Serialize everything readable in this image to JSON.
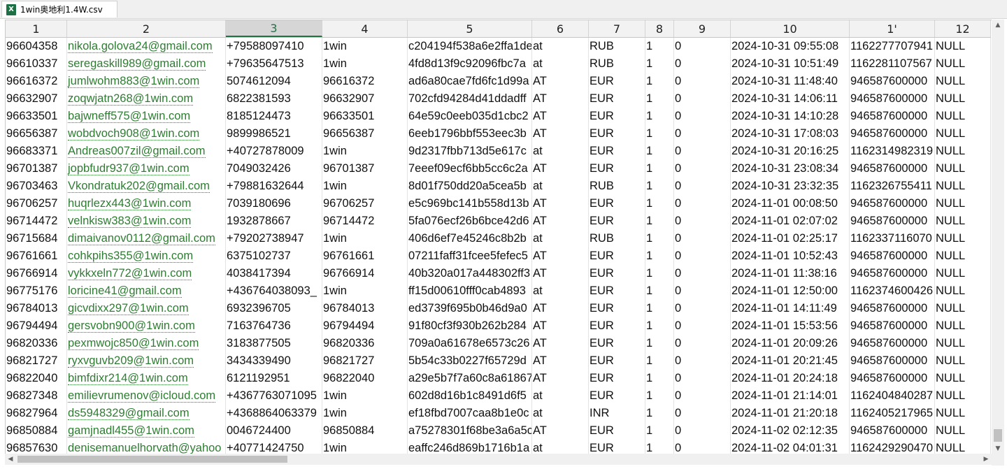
{
  "tab": {
    "name": "1win奥地利1.4W.csv",
    "icon": "excel-icon"
  },
  "columns": [
    "1",
    "2",
    "3",
    "4",
    "5",
    "6",
    "7",
    "8",
    "9",
    "10",
    "1'",
    "12"
  ],
  "active_column": 2,
  "rows": [
    [
      "96604358",
      "nikola.golova24@gmail.com",
      "+79588097410",
      "1win",
      "c204194f538a6e2ffa1de",
      "at",
      "RUB",
      "1",
      "0",
      "2024-10-31 09:55:08",
      "1162277707941",
      "NULL"
    ],
    [
      "96610337",
      "seregaskill989@gmail.com",
      "+79635647513",
      "1win",
      "4fd8d13f9c92096fbc7a",
      "at",
      "RUB",
      "1",
      "0",
      "2024-10-31 10:51:49",
      "1162281107567",
      "NULL"
    ],
    [
      "96616372",
      "jumlwohm883@1win.com",
      "5074612094",
      "96616372",
      "ad6a80cae7fd6fc1d99a",
      "AT",
      "EUR",
      "1",
      "0",
      "2024-10-31 11:48:40",
      "946587600000",
      "NULL"
    ],
    [
      "96632907",
      "zoqwjatn268@1win.com",
      "6822381593",
      "96632907",
      "702cfd94284d41ddadff",
      "AT",
      "EUR",
      "1",
      "0",
      "2024-10-31 14:06:11",
      "946587600000",
      "NULL"
    ],
    [
      "96633501",
      "bajwneff575@1win.com",
      "8185124473",
      "96633501",
      "64e59c0eeb035d1cbc2",
      "AT",
      "EUR",
      "1",
      "0",
      "2024-10-31 14:10:28",
      "946587600000",
      "NULL"
    ],
    [
      "96656387",
      "wobdvoch908@1win.com",
      "9899986521",
      "96656387",
      "6eeb1796bbf553eec3b",
      "AT",
      "EUR",
      "1",
      "0",
      "2024-10-31 17:08:03",
      "946587600000",
      "NULL"
    ],
    [
      "96683371",
      "Andreas007zil@gmail.com",
      "+40727878009",
      "1win",
      "9d2317fbb713d5e617c",
      "at",
      "EUR",
      "1",
      "0",
      "2024-10-31 20:16:25",
      "1162314982319",
      "NULL"
    ],
    [
      "96701387",
      "jopbfudr937@1win.com",
      "7049032426",
      "96701387",
      "7eeef09ecf6bb5cc6c2a",
      "AT",
      "EUR",
      "1",
      "0",
      "2024-10-31 23:08:34",
      "946587600000",
      "NULL"
    ],
    [
      "96703463",
      "Vkondratuk202@gmail.com",
      "+79881632644",
      "1win",
      "8d01f750dd20a5cea5b",
      "at",
      "RUB",
      "1",
      "0",
      "2024-10-31 23:32:35",
      "1162326755411",
      "NULL"
    ],
    [
      "96706257",
      "huqrlezx443@1win.com",
      "7039180696",
      "96706257",
      "e5c969bc141b558d13b",
      "AT",
      "EUR",
      "1",
      "0",
      "2024-11-01 00:08:50",
      "946587600000",
      "NULL"
    ],
    [
      "96714472",
      "velnkisw383@1win.com",
      "1932878667",
      "96714472",
      "5fa076ecf26b6bce42d6",
      "AT",
      "EUR",
      "1",
      "0",
      "2024-11-01 02:07:02",
      "946587600000",
      "NULL"
    ],
    [
      "96715684",
      "dimaivanov0112@gmail.com",
      "+79202738947",
      "1win",
      "406d6ef7e45246c8b2b",
      "at",
      "RUB",
      "1",
      "0",
      "2024-11-01 02:25:17",
      "1162337116070",
      "NULL"
    ],
    [
      "96761661",
      "cohkpihs355@1win.com",
      "6375102737",
      "96761661",
      "07211faff31fcee5fefec5",
      "AT",
      "EUR",
      "1",
      "0",
      "2024-11-01 10:52:43",
      "946587600000",
      "NULL"
    ],
    [
      "96766914",
      "vykkxeln772@1win.com",
      "4038417394",
      "96766914",
      "40b320a017a448302ff3",
      "AT",
      "EUR",
      "1",
      "0",
      "2024-11-01 11:38:16",
      "946587600000",
      "NULL"
    ],
    [
      "96775176",
      "loricine41@gmail.com",
      "+436764038093_",
      "1win",
      "ff15d00610fff0cab4893",
      "at",
      "EUR",
      "1",
      "0",
      "2024-11-01 12:50:00",
      "1162374600426",
      "NULL"
    ],
    [
      "96784013",
      "gicvdixx297@1win.com",
      "6932396705",
      "96784013",
      "ed3739f695b0b46d9a0",
      "AT",
      "EUR",
      "1",
      "0",
      "2024-11-01 14:11:49",
      "946587600000",
      "NULL"
    ],
    [
      "96794494",
      "gersvobn900@1win.com",
      "7163764736",
      "96794494",
      "91f80cf3f930b262b284",
      "AT",
      "EUR",
      "1",
      "0",
      "2024-11-01 15:53:56",
      "946587600000",
      "NULL"
    ],
    [
      "96820336",
      "pexmwojc850@1win.com",
      "3183877505",
      "96820336",
      "709a0a61678e6573c26",
      "AT",
      "EUR",
      "1",
      "0",
      "2024-11-01 20:09:26",
      "946587600000",
      "NULL"
    ],
    [
      "96821727",
      "ryxvguvb209@1win.com",
      "3434339490",
      "96821727",
      "5b54c33b0227f65729d",
      "AT",
      "EUR",
      "1",
      "0",
      "2024-11-01 20:21:45",
      "946587600000",
      "NULL"
    ],
    [
      "96822040",
      "bimfdixr214@1win.com",
      "6121192951",
      "96822040",
      "a29e5b7f7a60c8a61867",
      "AT",
      "EUR",
      "1",
      "0",
      "2024-11-01 20:24:18",
      "946587600000",
      "NULL"
    ],
    [
      "96827348",
      "emilievrumenov@icloud.com",
      "+4367763071095",
      "1win",
      "602d8d16b1c8491d6f5",
      "at",
      "EUR",
      "1",
      "0",
      "2024-11-01 21:14:01",
      "1162404840287",
      "NULL"
    ],
    [
      "96827964",
      "ds5948329@gmail.com",
      "+4368864063379",
      "1win",
      "ef18fbd7007caa8b1e0c",
      "at",
      "INR",
      "1",
      "0",
      "2024-11-01 21:20:18",
      "1162405217965",
      "NULL"
    ],
    [
      "96850884",
      "gamjnadl455@1win.com",
      "0046724400",
      "96850884",
      "a75278301f68be3a6a5c",
      "AT",
      "EUR",
      "1",
      "0",
      "2024-11-02 02:12:35",
      "946587600000",
      "NULL"
    ],
    [
      "96857630",
      "denisemanuelhorvath@yahoo",
      "+40771424750",
      "1win",
      "eaffc246d869b1716b1a",
      "at",
      "EUR",
      "1",
      "0",
      "2024-11-02 04:01:31",
      "1162429290470",
      "NULL"
    ]
  ],
  "scroll": {
    "up": "▲",
    "down": "▼",
    "left": "◀",
    "right": "▶"
  }
}
